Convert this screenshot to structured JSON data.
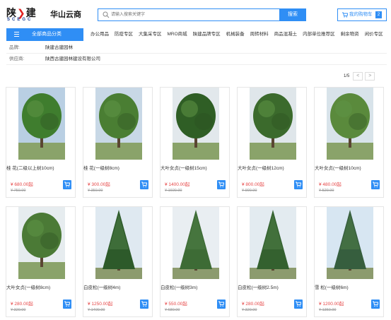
{
  "header": {
    "logo_mark": "陕",
    "logo_mark_2": "建",
    "logo_sub": "SCEGC",
    "brand": "华山云商",
    "search_placeholder": "请输入搜索关键字",
    "search_button": "搜索",
    "cart_label": "我的购物车",
    "cart_count": "2"
  },
  "nav": {
    "all_categories": "全部商品分类",
    "items": [
      "办公用品",
      "防疫专区",
      "大集采专区",
      "MRO商城",
      "陕建品牌专区",
      "机械装备",
      "周转材料",
      "商品混凝土",
      "内部单位推荐区",
      "剩余物资",
      "闲价专区"
    ]
  },
  "filter": {
    "rows": [
      {
        "key": "品牌:",
        "value": "陕建古建园林"
      },
      {
        "key": "供应商:",
        "value": "陕西古建园林建设有限公司"
      }
    ]
  },
  "pager": {
    "page": "1/5",
    "prev": "<",
    "next": ">"
  },
  "products": [
    {
      "name": "桂 花(二级以上树10cm)",
      "price": "¥ 680.00起",
      "old_price": "¥ 750.00",
      "tree": "round",
      "bg": "#b9cfe3",
      "leaf": "#3f7d2e"
    },
    {
      "name": "桂 花(一级树8cm)",
      "price": "¥ 300.00起",
      "old_price": "¥ 350.00",
      "tree": "round",
      "bg": "#c8d8e6",
      "leaf": "#4a7e33"
    },
    {
      "name": "大叶女贞(一级树15cm)",
      "price": "¥ 1400.00起",
      "old_price": "¥ 1600.00",
      "tree": "round",
      "bg": "#e2e8ec",
      "leaf": "#2f5e25"
    },
    {
      "name": "大叶女贞(一级树12cm)",
      "price": "¥ 800.00起",
      "old_price": "¥ 900.00",
      "tree": "round",
      "bg": "#dfe6ea",
      "leaf": "#3b6a2c"
    },
    {
      "name": "大叶女贞(一级树10cm)",
      "price": "¥ 480.00起",
      "old_price": "¥ 520.00",
      "tree": "round",
      "bg": "#d8e3ea",
      "leaf": "#5a8a3c"
    },
    {
      "name": "大叶女贞(一级树8cm)",
      "price": "¥ 280.00起",
      "old_price": "¥ 320.00",
      "tree": "round",
      "bg": "#e6ecef",
      "leaf": "#4b7a36"
    },
    {
      "name": "白皮松(一级树4m)",
      "price": "¥ 1250.00起",
      "old_price": "¥ 1400.00",
      "tree": "cone",
      "bg": "#dfe9f1",
      "leaf": "#2d5a2a"
    },
    {
      "name": "白皮松(一级树3m)",
      "price": "¥ 550.00起",
      "old_price": "¥ 680.00",
      "tree": "cone",
      "bg": "#e9eef2",
      "leaf": "#3d6b35"
    },
    {
      "name": "白皮松(一级树2.5m)",
      "price": "¥ 280.00起",
      "old_price": "¥ 320.00",
      "tree": "cone",
      "bg": "#e3ebf0",
      "leaf": "#34612f"
    },
    {
      "name": "雪 松(一级树6m)",
      "price": "¥ 1200.00起",
      "old_price": "¥ 1350.00",
      "tree": "cone",
      "bg": "#d7e6f2",
      "leaf": "#365e3e"
    }
  ]
}
